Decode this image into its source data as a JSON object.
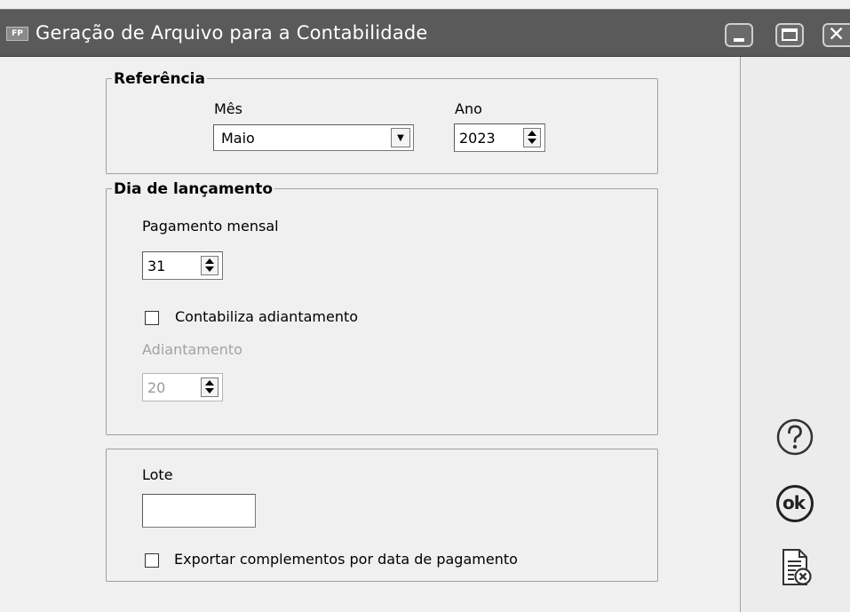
{
  "window": {
    "icon_text": "FP",
    "title": "Geração de Arquivo para a Contabilidade"
  },
  "referencia": {
    "title": "Referência",
    "mes_label": "Mês",
    "mes_value": "Maio",
    "ano_label": "Ano",
    "ano_value": "2023"
  },
  "dia_lancamento": {
    "title": "Dia de lançamento",
    "pagamento_label": "Pagamento mensal",
    "pagamento_value": "31",
    "contabiliza_label": "Contabiliza adiantamento",
    "contabiliza_checked": false,
    "adiantamento_label": "Adiantamento",
    "adiantamento_value": "20"
  },
  "lote": {
    "label": "Lote",
    "value": "",
    "exportar_label": "Exportar complementos por data de pagamento",
    "exportar_checked": false
  },
  "side_actions": {
    "help_icon": "help-icon",
    "ok_label": "ok",
    "cancel_icon": "cancel-document-icon"
  }
}
